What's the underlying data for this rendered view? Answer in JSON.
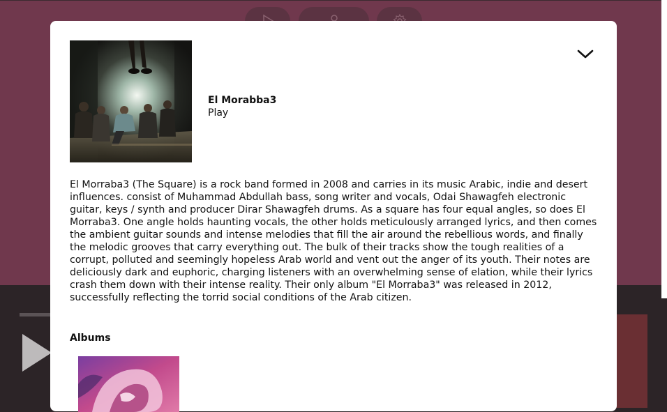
{
  "background": {
    "top_color": "#70384d",
    "bottom_color": "#2c2427",
    "toolbar": [
      {
        "name": "play",
        "icon": "play-icon"
      },
      {
        "name": "user",
        "icon": "user-icon"
      },
      {
        "name": "settings",
        "icon": "gear-icon"
      }
    ]
  },
  "modal": {
    "artist": {
      "name": "El Morabba3",
      "play_label": "Play"
    },
    "bio": "El Morraba3 (The Square) is a rock band formed in 2008 and carries in its music Arabic, indie and desert influences. consist of Muhammad Abdullah bass, song writer and vocals, Odai Shawagfeh electronic guitar, keys / synth and producer Dirar Shawagfeh drums. As a square has four equal angles, so does El Morraba3. One angle holds haunting vocals, the other holds meticulously arranged lyrics, and then comes the ambient guitar sounds and intense melodies that fill the air around the rebellious words, and finally the melodic grooves that carry everything out. The bulk of their tracks show the tough realities of a corrupt, polluted and seemingly hopeless Arab world and vent out the anger of its youth. Their notes are deliciously dark and euphoric, charging listeners with an overwhelming sense of elation, while their lyrics crash them down with their intense reality. Their only album \"El Morraba3\" was released in 2012, successfully reflecting the torrid social conditions of the Arab citizen.",
    "albums_heading": "Albums",
    "collapse_icon": "chevron-down-icon"
  }
}
